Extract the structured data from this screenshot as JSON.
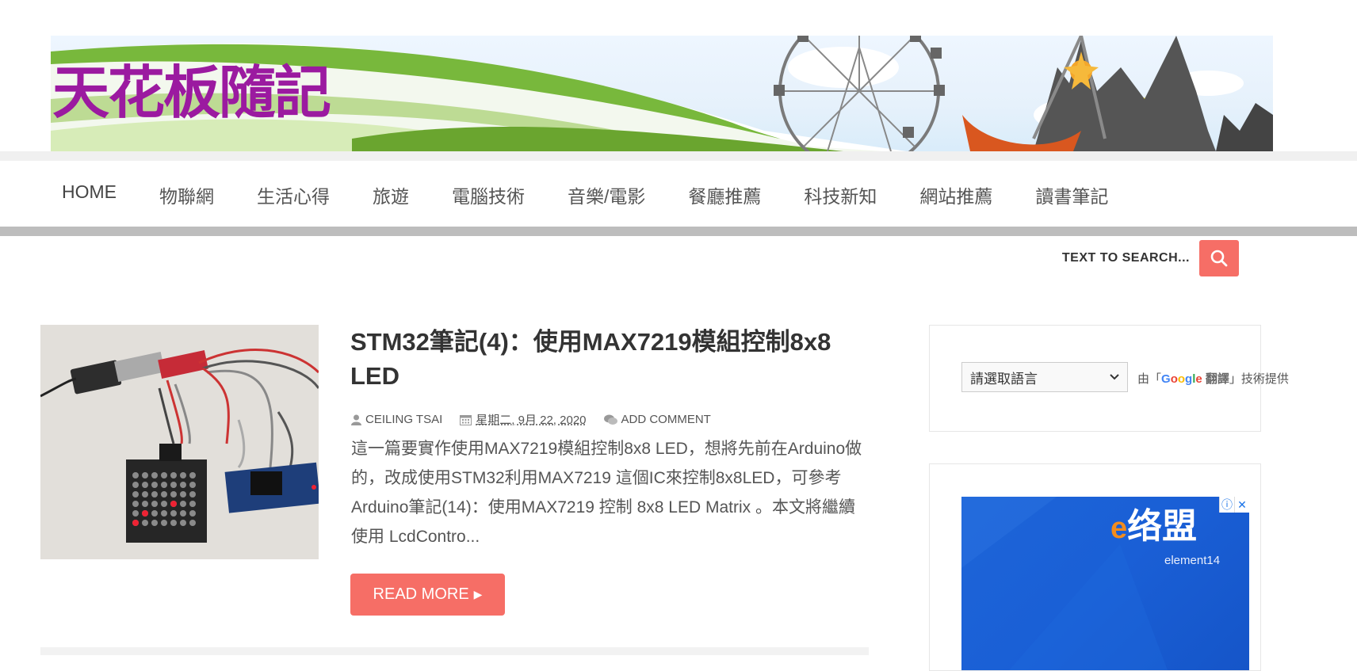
{
  "site": {
    "title": "天花板隨記"
  },
  "nav": {
    "items": [
      "HOME",
      "物聯網",
      "生活心得",
      "旅遊",
      "電腦技術",
      "音樂/電影",
      "餐廳推薦",
      "科技新知",
      "網站推薦",
      "讀書筆記"
    ]
  },
  "search": {
    "label": "TEXT TO SEARCH..."
  },
  "post": {
    "title": "STM32筆記(4)：使用MAX7219模組控制8x8 LED",
    "author": "CEILING TSAI",
    "date": "星期二, 9月 22, 2020",
    "comments": "ADD COMMENT",
    "excerpt": "這一篇要實作使用MAX7219模組控制8x8 LED，想將先前在Arduino做的，改成使用STM32利用MAX7219 這個IC來控制8x8LED，可參考  Arduino筆記(14)：使用MAX7219 控制 8x8 LED Matrix 。本文將繼續使用 LcdContro...",
    "read_more": "READ MORE"
  },
  "sidebar": {
    "translate": {
      "select_value": "請選取語言",
      "powered_prefix": "由「",
      "google_g": "G",
      "google_o1": "o",
      "google_o2": "o",
      "google_g2": "g",
      "google_l": "l",
      "google_e": "e",
      "translate_word": "翻譯",
      "powered_suffix": "」技術提供"
    },
    "ad": {
      "logo_e": "e",
      "logo_text": "络盟",
      "logo_sub": "element14"
    }
  },
  "colors": {
    "accent": "#f66e66",
    "title_purple": "#9b1aa0",
    "nav_bar": "#bdbdbd"
  }
}
